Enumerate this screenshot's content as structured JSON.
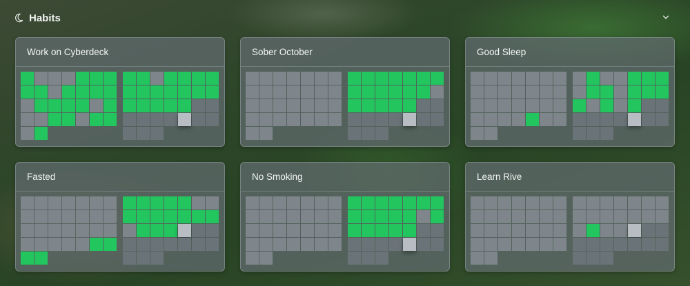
{
  "section": {
    "title": "Habits"
  },
  "colors": {
    "done": "#22c55e",
    "neutral": "#7e868b",
    "future": "#6a7378",
    "today": "#b7bdc2"
  },
  "legend_codes": {
    "1": "done",
    "0": "not done",
    "f": "future",
    "t": "today",
    "e": "empty"
  },
  "habits": [
    {
      "name": "Work on Cyberdeck",
      "months": [
        [
          [
            1,
            0,
            0,
            0,
            1,
            1,
            1
          ],
          [
            1,
            1,
            0,
            1,
            1,
            1,
            1
          ],
          [
            0,
            1,
            1,
            1,
            1,
            0,
            1
          ],
          [
            0,
            0,
            1,
            1,
            0,
            1,
            1
          ],
          [
            0,
            1,
            "e",
            "e",
            "e",
            "e",
            "e"
          ]
        ],
        [
          [
            1,
            1,
            0,
            1,
            1,
            1,
            1
          ],
          [
            1,
            1,
            1,
            1,
            1,
            1,
            1
          ],
          [
            1,
            1,
            1,
            1,
            1,
            "f",
            "f"
          ],
          [
            "f",
            "f",
            "f",
            "f",
            "t",
            "f",
            "f"
          ],
          [
            "f",
            "f",
            "f",
            "e",
            "e",
            "e",
            "e"
          ]
        ]
      ]
    },
    {
      "name": "Sober October",
      "months": [
        [
          [
            0,
            0,
            0,
            0,
            0,
            0,
            0
          ],
          [
            0,
            0,
            0,
            0,
            0,
            0,
            0
          ],
          [
            0,
            0,
            0,
            0,
            0,
            0,
            0
          ],
          [
            0,
            0,
            0,
            0,
            0,
            0,
            0
          ],
          [
            0,
            0,
            "e",
            "e",
            "e",
            "e",
            "e"
          ]
        ],
        [
          [
            1,
            1,
            1,
            1,
            1,
            1,
            1
          ],
          [
            1,
            1,
            1,
            1,
            1,
            1,
            0
          ],
          [
            1,
            1,
            1,
            1,
            1,
            "f",
            "f"
          ],
          [
            "f",
            "f",
            "f",
            "f",
            "t",
            "f",
            "f"
          ],
          [
            "f",
            "f",
            "f",
            "e",
            "e",
            "e",
            "e"
          ]
        ]
      ]
    },
    {
      "name": "Good Sleep",
      "months": [
        [
          [
            0,
            0,
            0,
            0,
            0,
            0,
            0
          ],
          [
            0,
            0,
            0,
            0,
            0,
            0,
            0
          ],
          [
            0,
            0,
            0,
            0,
            0,
            0,
            0
          ],
          [
            0,
            0,
            0,
            0,
            1,
            0,
            0
          ],
          [
            0,
            0,
            "e",
            "e",
            "e",
            "e",
            "e"
          ]
        ],
        [
          [
            0,
            1,
            0,
            0,
            1,
            1,
            1
          ],
          [
            0,
            1,
            1,
            0,
            1,
            1,
            1
          ],
          [
            1,
            0,
            1,
            0,
            1,
            "f",
            "f"
          ],
          [
            "f",
            "f",
            "f",
            "f",
            "t",
            "f",
            "f"
          ],
          [
            "f",
            "f",
            "f",
            "e",
            "e",
            "e",
            "e"
          ]
        ]
      ]
    },
    {
      "name": "Fasted",
      "months": [
        [
          [
            0,
            0,
            0,
            0,
            0,
            0,
            0
          ],
          [
            0,
            0,
            0,
            0,
            0,
            0,
            0
          ],
          [
            0,
            0,
            0,
            0,
            0,
            0,
            0
          ],
          [
            0,
            0,
            0,
            0,
            0,
            1,
            1
          ],
          [
            1,
            1,
            "e",
            "e",
            "e",
            "e",
            "e"
          ]
        ],
        [
          [
            1,
            1,
            1,
            1,
            1,
            0,
            0
          ],
          [
            1,
            1,
            1,
            1,
            1,
            1,
            1
          ],
          [
            0,
            1,
            1,
            1,
            "t",
            "f",
            "f"
          ],
          [
            "f",
            "f",
            "f",
            "f",
            "f",
            "f",
            "f"
          ],
          [
            "f",
            "f",
            "f",
            "e",
            "e",
            "e",
            "e"
          ]
        ]
      ]
    },
    {
      "name": "No Smoking",
      "months": [
        [
          [
            0,
            0,
            0,
            0,
            0,
            0,
            0
          ],
          [
            0,
            0,
            0,
            0,
            0,
            0,
            0
          ],
          [
            0,
            0,
            0,
            0,
            0,
            0,
            0
          ],
          [
            0,
            0,
            0,
            0,
            0,
            0,
            0
          ],
          [
            0,
            0,
            "e",
            "e",
            "e",
            "e",
            "e"
          ]
        ],
        [
          [
            1,
            1,
            1,
            1,
            1,
            1,
            1
          ],
          [
            1,
            1,
            1,
            1,
            1,
            0,
            1
          ],
          [
            1,
            1,
            1,
            1,
            1,
            "f",
            "f"
          ],
          [
            "f",
            "f",
            "f",
            "f",
            "t",
            "f",
            "f"
          ],
          [
            "f",
            "f",
            "f",
            "e",
            "e",
            "e",
            "e"
          ]
        ]
      ]
    },
    {
      "name": "Learn Rive",
      "months": [
        [
          [
            0,
            0,
            0,
            0,
            0,
            0,
            0
          ],
          [
            0,
            0,
            0,
            0,
            0,
            0,
            0
          ],
          [
            0,
            0,
            0,
            0,
            0,
            0,
            0
          ],
          [
            0,
            0,
            0,
            0,
            0,
            0,
            0
          ],
          [
            0,
            0,
            "e",
            "e",
            "e",
            "e",
            "e"
          ]
        ],
        [
          [
            0,
            0,
            0,
            0,
            0,
            0,
            0
          ],
          [
            0,
            0,
            0,
            0,
            0,
            0,
            0
          ],
          [
            0,
            1,
            0,
            0,
            "t",
            "f",
            "f"
          ],
          [
            "f",
            "f",
            "f",
            "f",
            "f",
            "f",
            "f"
          ],
          [
            "f",
            "f",
            "f",
            "e",
            "e",
            "e",
            "e"
          ]
        ]
      ]
    }
  ]
}
